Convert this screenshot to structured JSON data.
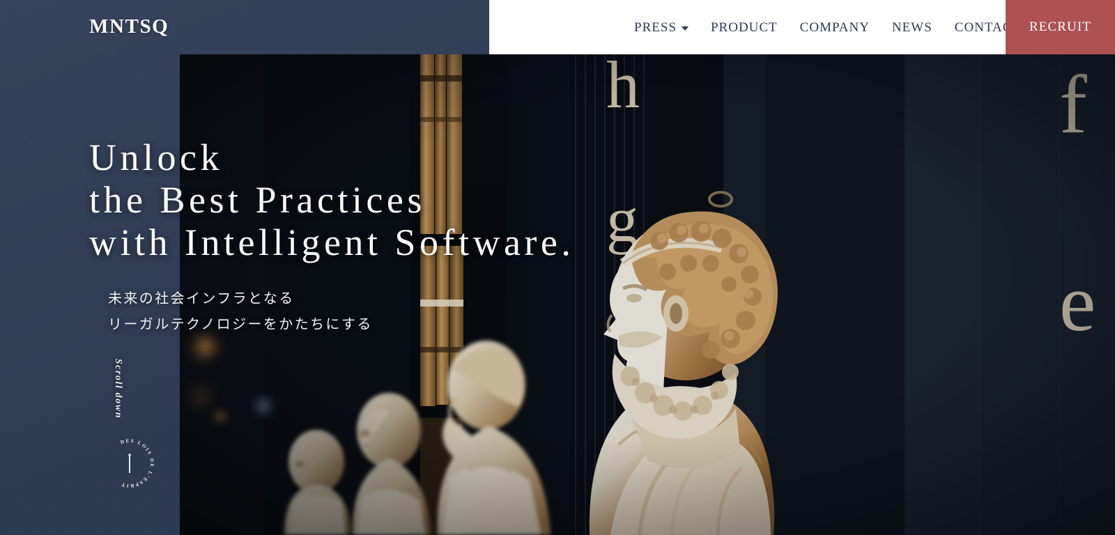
{
  "site": {
    "logo": "MNTSQ"
  },
  "nav": {
    "items": [
      {
        "label": "PRESS",
        "has_dropdown": true,
        "icon": "chevron-down-icon"
      },
      {
        "label": "PRODUCT",
        "has_dropdown": false
      },
      {
        "label": "COMPANY",
        "has_dropdown": false
      },
      {
        "label": "NEWS",
        "has_dropdown": false
      },
      {
        "label": "CONTACT",
        "has_dropdown": false
      }
    ],
    "cta": {
      "label": "RECRUIT",
      "background": "#ae5152",
      "color": "#ffffff"
    }
  },
  "hero": {
    "headline_lines": [
      "Unlock",
      "the Best Practices",
      "with Intelligent Software."
    ],
    "subcopy_lines": [
      "未来の社会インフラとなる",
      "リーガルテクノロジーをかたちにする"
    ],
    "scroll_hint": "Scroll down",
    "emblem_text": "DES LOIS DE L'ESPRIT",
    "image_description": "Row of marble philosopher busts in a dark wooden library with gilded book spines and large serif shelf letters h, g, f, e"
  },
  "colors": {
    "navy": "#2e3c54",
    "accent_red": "#ae5152",
    "nav_panel": "#ffffff",
    "nav_text": "#2b3a52",
    "hero_text": "#ffffff"
  }
}
